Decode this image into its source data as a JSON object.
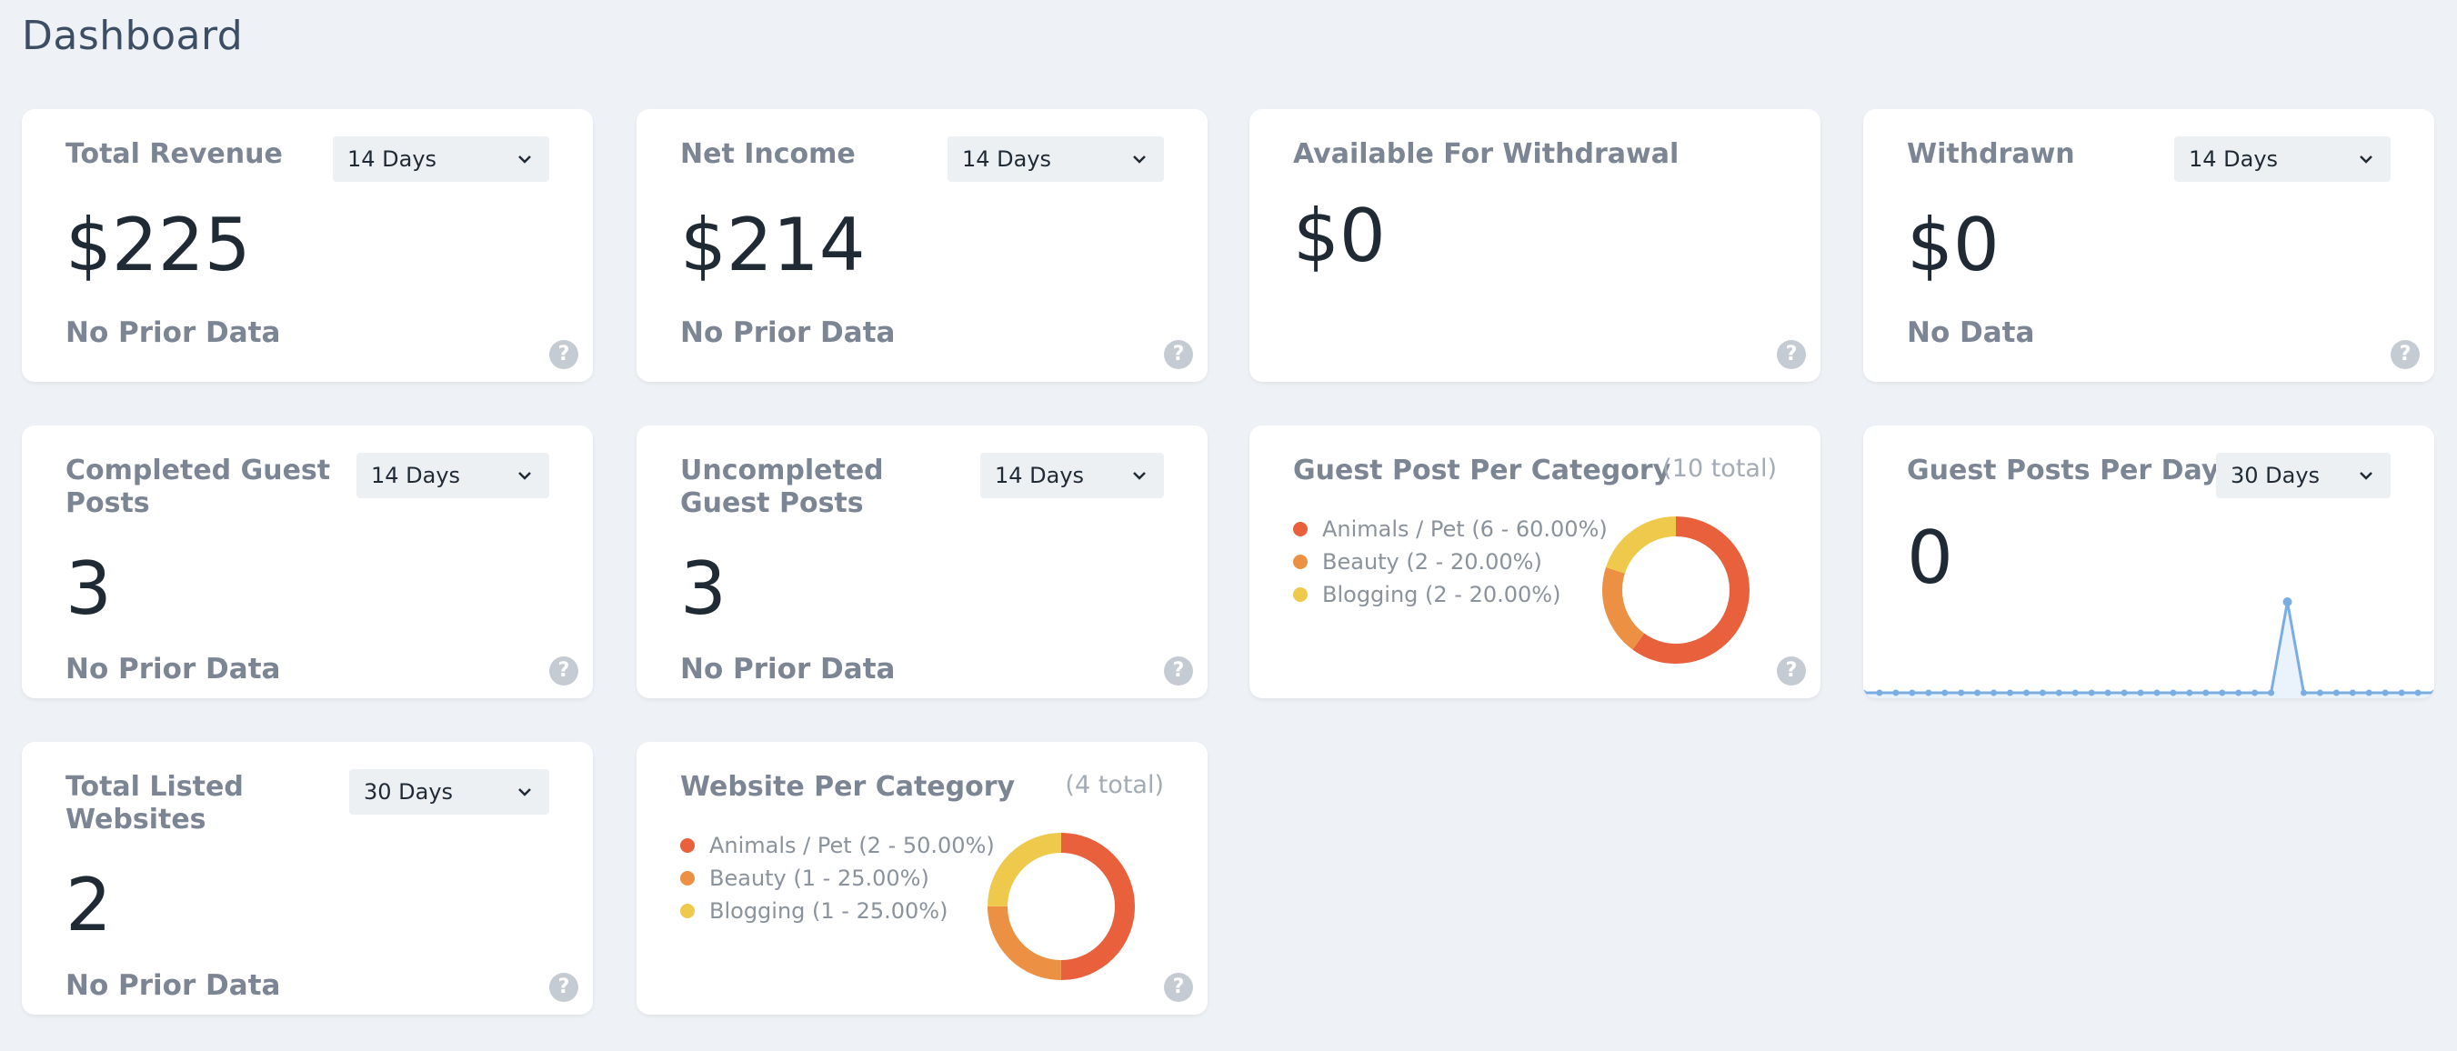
{
  "page": {
    "title": "Dashboard"
  },
  "cards": {
    "total_revenue": {
      "title": "Total Revenue",
      "range": "14 Days",
      "value": "$225",
      "sub": "No Prior Data"
    },
    "net_income": {
      "title": "Net Income",
      "range": "14 Days",
      "value": "$214",
      "sub": "No Prior Data"
    },
    "available": {
      "title": "Available For Withdrawal",
      "value": "$0"
    },
    "withdrawn": {
      "title": "Withdrawn",
      "range": "14 Days",
      "value": "$0",
      "sub": "No Data"
    },
    "completed": {
      "title": "Completed Guest Posts",
      "range": "14 Days",
      "value": "3",
      "sub": "No Prior Data"
    },
    "uncompleted": {
      "title": "Uncompleted Guest Posts",
      "range": "14 Days",
      "value": "3",
      "sub": "No Prior Data"
    },
    "guest_per_category": {
      "title": "Guest Post Per Category",
      "total": "(10 total)",
      "legend": [
        {
          "label": "Animals / Pet (6 - 60.00%)",
          "color": "#e8603c",
          "value": 6
        },
        {
          "label": "Beauty (2 - 20.00%)",
          "color": "#ec9144",
          "value": 2
        },
        {
          "label": "Blogging (2 - 20.00%)",
          "color": "#efc94c",
          "value": 2
        }
      ]
    },
    "guest_per_day": {
      "title": "Guest Posts Per Day",
      "range": "30 Days",
      "value": "0",
      "line_color": "#7aaee3",
      "points": [
        0,
        0,
        0,
        0,
        0,
        0,
        0,
        0,
        0,
        0,
        0,
        0,
        0,
        0,
        0,
        0,
        0,
        0,
        0,
        0,
        0,
        0,
        0,
        0,
        0,
        0,
        1,
        0,
        0,
        0,
        0,
        0,
        0,
        0,
        0,
        0
      ]
    },
    "total_listed": {
      "title": "Total Listed Websites",
      "range": "30 Days",
      "value": "2",
      "sub": "No Prior Data"
    },
    "website_per_category": {
      "title": "Website Per Category",
      "total": "(4 total)",
      "legend": [
        {
          "label": "Animals / Pet (2 - 50.00%)",
          "color": "#e8603c",
          "value": 2
        },
        {
          "label": "Beauty (1 - 25.00%)",
          "color": "#ec9144",
          "value": 1
        },
        {
          "label": "Blogging (1 - 25.00%)",
          "color": "#efc94c",
          "value": 1
        }
      ]
    }
  },
  "help_glyph": "?"
}
